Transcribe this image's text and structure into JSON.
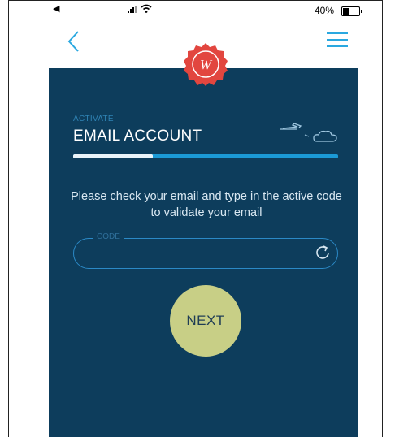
{
  "status_bar": {
    "battery_percent": "40%",
    "battery_level": 0.4
  },
  "activation": {
    "step_label": "ACTIVATE",
    "title": "EMAIL ACCOUNT",
    "progress": 0.3,
    "message": "Please check your email and type in the active code to validate your email",
    "code_label": "CODE",
    "code_value": "",
    "next_label": "NEXT"
  },
  "badge": {
    "letter": "W"
  },
  "colors": {
    "accent": "#2aa8e0",
    "panel": "#0d3d5c",
    "badge": "#e2463f",
    "next_button": "#c8cf86"
  }
}
